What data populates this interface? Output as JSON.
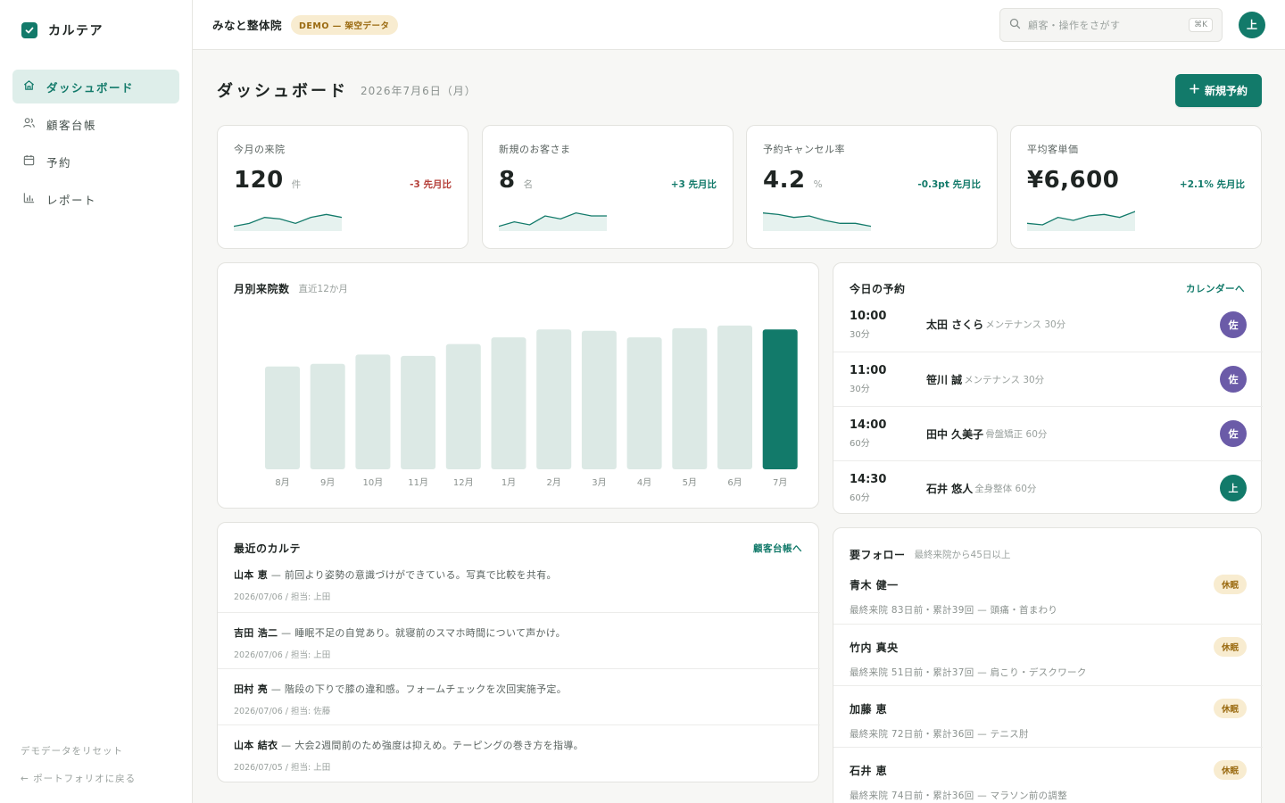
{
  "brand": {
    "name": "カルテア"
  },
  "sidebar": {
    "items": [
      {
        "label": "ダッシュボード",
        "icon": "home-icon",
        "active": true
      },
      {
        "label": "顧客台帳",
        "icon": "users-icon"
      },
      {
        "label": "予約",
        "icon": "calendar-icon"
      },
      {
        "label": "レポート",
        "icon": "bar-chart-icon"
      }
    ],
    "reset_label": "デモデータをリセット",
    "back_label": "← ポートフォリオに戻る"
  },
  "topbar": {
    "clinic": "みなと整体院",
    "badge": "DEMO — 架空データ",
    "search_placeholder": "顧客・操作をさがす",
    "search_shortcut": "⌘K",
    "user_initial": "上"
  },
  "page": {
    "title": "ダッシュボード",
    "date": "2026年7月6日（月）",
    "new_button": "新規予約"
  },
  "kpis": [
    {
      "label": "今月の来院",
      "value": "120",
      "unit": "件",
      "delta": "-3 先月比",
      "trend": "negative",
      "spark": [
        2,
        4,
        8,
        7,
        4,
        8,
        10,
        8
      ]
    },
    {
      "label": "新規のお客さま",
      "value": "8",
      "unit": "名",
      "delta": "+3 先月比",
      "trend": "positive",
      "spark": [
        2,
        5,
        3,
        9,
        7,
        11,
        9,
        9
      ]
    },
    {
      "label": "予約キャンセル率",
      "value": "4.2",
      "unit": "%",
      "delta": "-0.3pt 先月比",
      "trend": "positive",
      "spark": [
        11,
        10,
        8,
        9,
        6,
        4,
        4,
        2
      ]
    },
    {
      "label": "平均客単価",
      "value": "¥6,600",
      "unit": "",
      "delta": "+2.1% 先月比",
      "trend": "positive",
      "spark": [
        4,
        3,
        8,
        6,
        9,
        10,
        8,
        12
      ]
    }
  ],
  "monthly": {
    "title": "月別来院数",
    "subtitle": "直近12か月"
  },
  "chart_data": {
    "type": "bar",
    "categories": [
      "8月",
      "9月",
      "10月",
      "11月",
      "12月",
      "1月",
      "2月",
      "3月",
      "4月",
      "5月",
      "6月",
      "7月"
    ],
    "values": [
      78,
      80,
      87,
      86,
      95,
      100,
      106,
      105,
      100,
      107,
      109,
      106
    ],
    "highlight_last": true,
    "ylim": [
      0,
      115
    ],
    "colors": {
      "bar": "#dce9e5",
      "highlight": "#127a6a"
    }
  },
  "appointments": {
    "title": "今日の予約",
    "link": "カレンダーへ",
    "items": [
      {
        "time": "10:00",
        "duration": "30分",
        "name": "太田 さくら",
        "menu": "メンテナンス 30分",
        "staff": "佐",
        "color": "#6b5ba8"
      },
      {
        "time": "11:00",
        "duration": "30分",
        "name": "笹川 誠",
        "menu": "メンテナンス 30分",
        "staff": "佐",
        "color": "#6b5ba8"
      },
      {
        "time": "14:00",
        "duration": "60分",
        "name": "田中 久美子",
        "menu": "骨盤矯正 60分",
        "staff": "佐",
        "color": "#6b5ba8"
      },
      {
        "time": "14:30",
        "duration": "60分",
        "name": "石井 悠人",
        "menu": "全身整体 60分",
        "staff": "上",
        "color": "#127a6a"
      }
    ]
  },
  "notes": {
    "title": "最近のカルテ",
    "link": "顧客台帳へ",
    "items": [
      {
        "name": "山本 恵",
        "text": " — 前回より姿勢の意識づけができている。写真で比較を共有。",
        "meta": "2026/07/06 / 担当: 上田"
      },
      {
        "name": "吉田 浩二",
        "text": " — 睡眠不足の自覚あり。就寝前のスマホ時間について声かけ。",
        "meta": "2026/07/06 / 担当: 上田"
      },
      {
        "name": "田村 亮",
        "text": " — 階段の下りで膝の違和感。フォームチェックを次回実施予定。",
        "meta": "2026/07/06 / 担当: 佐藤"
      },
      {
        "name": "山本 結衣",
        "text": " — 大会2週間前のため強度は抑えめ。テーピングの巻き方を指導。",
        "meta": "2026/07/05 / 担当: 上田"
      }
    ]
  },
  "followups": {
    "title": "要フォロー",
    "subtitle": "最終来院から45日以上",
    "items": [
      {
        "name": "青木 健一",
        "badge": "休眠",
        "meta": "最終来院 83日前・累計39回 — 頭痛・首まわり"
      },
      {
        "name": "竹内 真央",
        "badge": "休眠",
        "meta": "最終来院 51日前・累計37回 — 肩こり・デスクワーク"
      },
      {
        "name": "加藤 恵",
        "badge": "休眠",
        "meta": "最終来院 72日前・累計36回 — テニス肘"
      },
      {
        "name": "石井 恵",
        "badge": "休眠",
        "meta": "最終来院 74日前・累計36回 — マラソン前の調整"
      }
    ]
  }
}
